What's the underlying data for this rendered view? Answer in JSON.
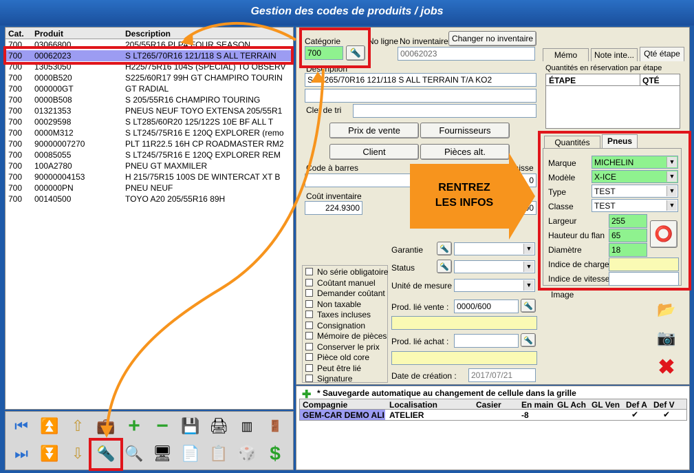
{
  "window": {
    "title": "Gestion des codes de produits / jobs"
  },
  "grid": {
    "headers": [
      "Cat.",
      "Produit",
      "Description"
    ],
    "rows": [
      {
        "cat": "700",
        "produit": "03066800",
        "desc": "205/55R16 PLP4 FOUR SEASON"
      },
      {
        "cat": "700",
        "produit": "00062023",
        "desc": "S LT265/70R16 121/118 S ALL TERRAIN"
      },
      {
        "cat": "700",
        "produit": "13053050",
        "desc": "H225/75R16 104S (SPECIAL) TO OBSERV"
      },
      {
        "cat": "700",
        "produit": "0000B520",
        "desc": "S225/60R17 99H GT CHAMPIRO TOURIN"
      },
      {
        "cat": "700",
        "produit": "000000GT",
        "desc": "GT RADIAL"
      },
      {
        "cat": "700",
        "produit": "0000B508",
        "desc": "S 205/55R16 CHAMPIRO TOURING"
      },
      {
        "cat": "700",
        "produit": "01321353",
        "desc": "PNEUS NEUF TOYO EXTENSA 205/55R1"
      },
      {
        "cat": "700",
        "produit": "00029598",
        "desc": "S LT285/60R20 125/122S 10E BF ALL T"
      },
      {
        "cat": "700",
        "produit": "0000M312",
        "desc": "S LT245/75R16 E 120Q EXPLORER (remo"
      },
      {
        "cat": "700",
        "produit": "90000007270",
        "desc": "PLT 11R22.5 16H CP ROADMASTER RM2"
      },
      {
        "cat": "700",
        "produit": "00085055",
        "desc": "S LT245/75R16 E 120Q EXPLORER REM"
      },
      {
        "cat": "700",
        "produit": "100A2780",
        "desc": "PNEU GT MAXMILER"
      },
      {
        "cat": "700",
        "produit": "90000004153",
        "desc": "H 215/75R15 100S DE WINTERCAT XT B"
      },
      {
        "cat": "700",
        "produit": "000000PN",
        "desc": "PNEU NEUF"
      },
      {
        "cat": "700",
        "produit": "00140500",
        "desc": "TOYO A20 205/55R16 89H"
      }
    ]
  },
  "form": {
    "categorie_label": "Catégorie",
    "categorie_value": "700",
    "no_ligne_label": "No ligne",
    "no_inventaire_label": "No inventaire",
    "no_inventaire_value": "00062023",
    "changer_btn": "Changer no inventaire",
    "description_label": "Description",
    "description_value": "S LT265/70R16 121/118 S ALL TERRAIN T/A KO2",
    "clef_label": "Clef de tri",
    "btn_prix": "Prix de vente",
    "btn_fournisseurs": "Fournisseurs",
    "btn_client": "Client",
    "btn_pieces": "Pièces alt.",
    "code_barres_label": "Code à barres",
    "qte_caisse_label": "Qté caisse",
    "qte_caisse_value": "0",
    "cout_label": "Coût inventaire",
    "cout_value": "224.9300",
    "right_value": ".00",
    "garantie_label": "Garantie",
    "status_label": "Status",
    "unite_label": "Unité de mesure",
    "prod_vente_label": "Prod. lié vente :",
    "prod_vente_value": "0000/600",
    "prod_achat_label": "Prod. lié achat :",
    "date_label": "Date de création :",
    "date_value": "2017/07/21",
    "image_label": "Image"
  },
  "checkboxes": [
    "No série obligatoire",
    "Coûtant manuel",
    "Demander coûtant",
    "Non taxable",
    "Taxes incluses",
    "Consignation",
    "Mémoire de pièces",
    "Conserver le prix",
    "Pièce old core",
    "Peut être lié",
    "Signature"
  ],
  "top_tabs": [
    "Mémo",
    "Note inte...",
    "Qté étape"
  ],
  "etape_group": "Quantités en réservation par étape",
  "etape_cols": [
    "ÉTAPE",
    "QTÉ"
  ],
  "pneus_tabs": [
    "Quantités",
    "Pneus"
  ],
  "pneus": {
    "marque_label": "Marque",
    "marque_value": "MICHELIN",
    "modele_label": "Modèle",
    "modele_value": "X-ICE",
    "type_label": "Type",
    "type_value": "TEST",
    "classe_label": "Classe",
    "classe_value": "TEST",
    "largeur_label": "Largeur",
    "largeur_value": "255",
    "hauteur_label": "Hauteur du flan",
    "hauteur_value": "65",
    "diametre_label": "Diamètre",
    "diametre_value": "18",
    "charge_label": "Indice de charge",
    "vitesse_label": "Indice de vitesse"
  },
  "callout": {
    "line1": "RENTREZ",
    "line2": "LES INFOS"
  },
  "bottom": {
    "autosave": "* Sauvegarde automatique au changement de cellule dans la grille",
    "headers": [
      "Compagnie",
      "Localisation",
      "Casier",
      "En main",
      "GL Ach",
      "GL Ven",
      "Def A",
      "Def V"
    ],
    "row": {
      "compagnie": "GEM-CAR DEMO ALI",
      "localisation": "ATELIER",
      "casier": "",
      "en_main": "-8",
      "gl_ach": "",
      "gl_ven": "",
      "def_a": "✔",
      "def_v": "✔"
    }
  },
  "colors": {
    "accent_red": "#e0151b",
    "orange": "#f7941d",
    "selection": "#9c9cf2",
    "green_field": "#8ff28f"
  }
}
